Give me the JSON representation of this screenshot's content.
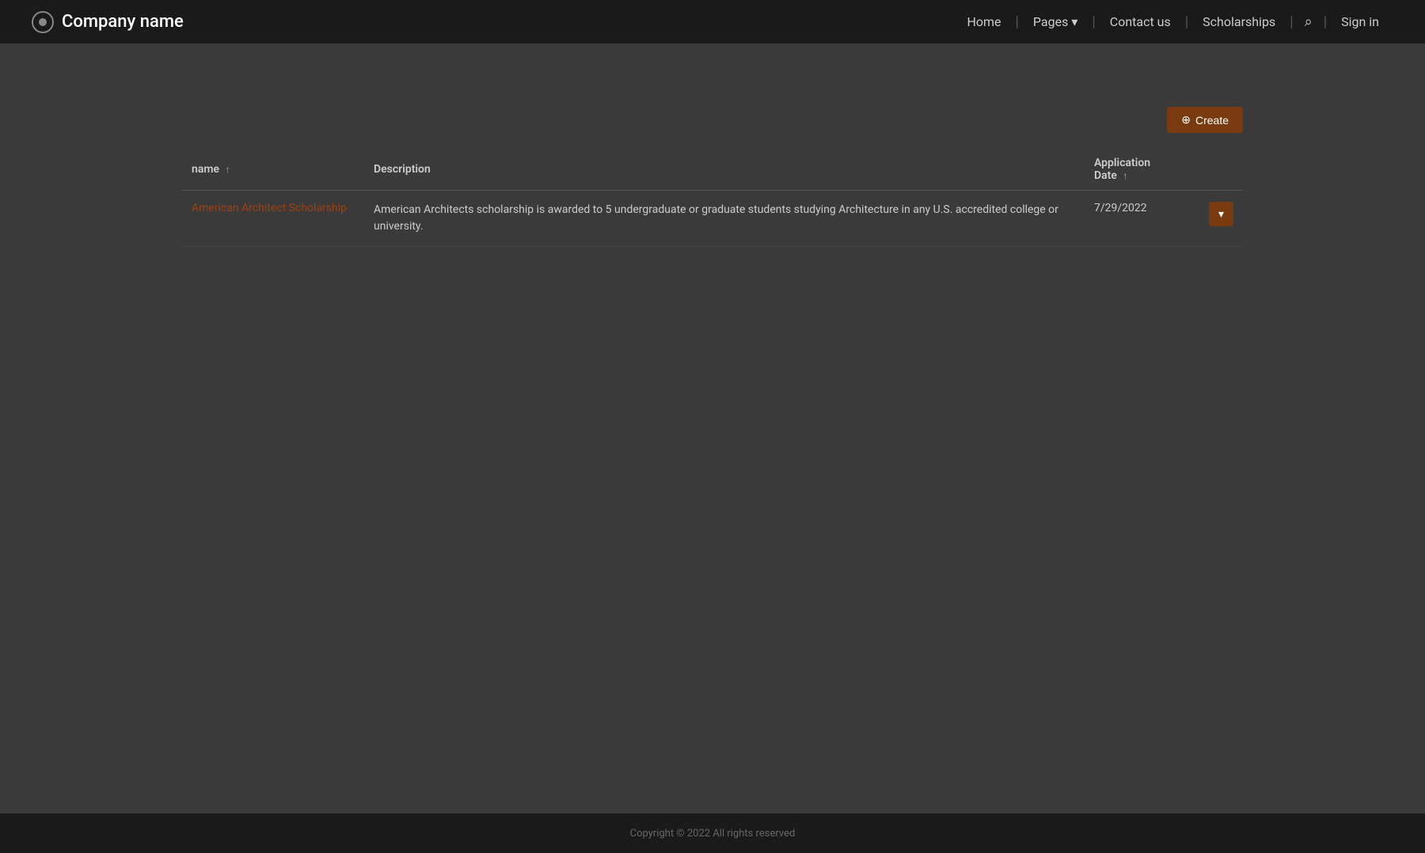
{
  "nav": {
    "brand": "Company name",
    "home_label": "Home",
    "pages_label": "Pages",
    "contact_label": "Contact us",
    "scholarships_label": "Scholarships",
    "signin_label": "Sign in"
  },
  "toolbar": {
    "create_label": "Create",
    "create_icon": "+"
  },
  "table": {
    "columns": [
      {
        "key": "name",
        "label": "name",
        "sortable": true
      },
      {
        "key": "description",
        "label": "Description",
        "sortable": true
      },
      {
        "key": "application_date",
        "label": "Application Date",
        "sortable": true
      }
    ],
    "rows": [
      {
        "name": "American Architect Scholarship",
        "description": "American Architects scholarship is awarded to 5 undergraduate or graduate students studying Architecture in any U.S. accredited college or university.",
        "application_date": "7/29/2022"
      }
    ],
    "action_icon": "▾"
  },
  "footer": {
    "copyright": "Copyright © 2022  All rights reserved"
  }
}
